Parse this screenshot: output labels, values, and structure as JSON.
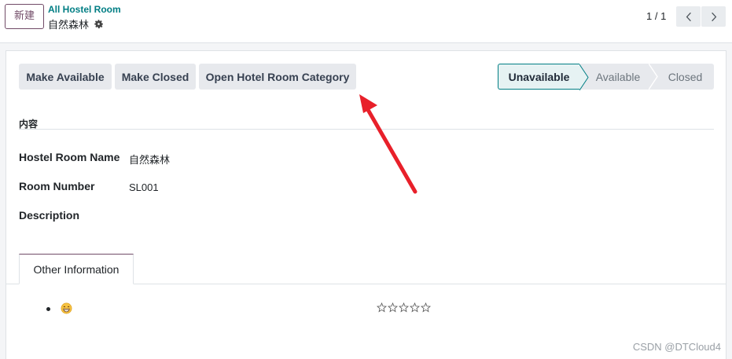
{
  "toolbar": {
    "new_button_label": "新建",
    "breadcrumb": "All Hostel Room",
    "record_name": "自然森林",
    "pager": "1 / 1"
  },
  "actions": {
    "make_available": "Make Available",
    "make_closed": "Make Closed",
    "open_category": "Open Hotel Room Category"
  },
  "statusbar": {
    "stages": [
      "Unavailable",
      "Available",
      "Closed"
    ],
    "active": "Unavailable"
  },
  "form": {
    "group_title": "内容",
    "fields": {
      "hostel_room_name": {
        "label": "Hostel Room Name",
        "value": "自然森林"
      },
      "room_number": {
        "label": "Room Number",
        "value": "SL001"
      },
      "description": {
        "label": "Description",
        "value": ""
      }
    }
  },
  "notebook": {
    "tabs": [
      {
        "label": "Other Information",
        "active": true
      }
    ],
    "rating": {
      "stars_filled": 0,
      "stars_total": 5
    }
  },
  "watermark": "CSDN @DTCloud4",
  "colors": {
    "brand": "#714b67",
    "link": "#017e84",
    "status_active_bg": "#e6f2f3",
    "button_bg": "#e7e9ed",
    "annotation": "#e8202a"
  },
  "icons": [
    "gear-icon",
    "chevron-left-icon",
    "chevron-right-icon",
    "emoji-icon",
    "star-icon",
    "annotation-arrow-icon"
  ]
}
